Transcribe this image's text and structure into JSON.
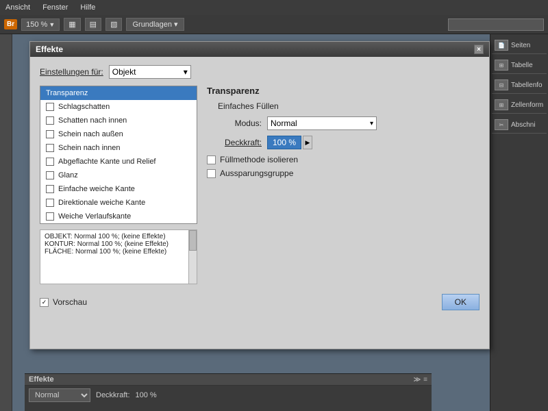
{
  "menubar": {
    "items": [
      "Ansicht",
      "Fenster",
      "Hilfe"
    ]
  },
  "toolbar": {
    "logo": "Br",
    "zoom": "150 %",
    "zoom_arrow": "▼",
    "layout_btn1": "▦",
    "layout_btn2": "▤",
    "layout_btn3": "▧",
    "grundlagen": "Grundlagen",
    "search_placeholder": ""
  },
  "modal": {
    "title": "Effekte",
    "settings_label": "Einstellungen für:",
    "settings_value": "Objekt",
    "right_title": "Transparenz",
    "section_fill": "Einfaches Füllen",
    "modus_label": "Modus:",
    "modus_value": "Normal",
    "deckkraft_label": "Deckkraft:",
    "deckkraft_value": "100 %",
    "cb_fuellmethode": "Füllmethode isolieren",
    "cb_aussparungsgruppe": "Aussparungsgruppe",
    "preview_label": "Vorschau",
    "ok_label": "OK",
    "preview_lines": [
      "OBJEKT: Normal 100 %; (keine Effekte)",
      "KONTUR: Normal 100 %; (keine Effekte)",
      "FLÄCHE: Normal 100 %; (keine Effekte)"
    ]
  },
  "effects_list": [
    {
      "label": "Transparenz",
      "selected": true,
      "checked": false
    },
    {
      "label": "Schlagschatten",
      "selected": false,
      "checked": false
    },
    {
      "label": "Schatten nach innen",
      "selected": false,
      "checked": false
    },
    {
      "label": "Schein nach außen",
      "selected": false,
      "checked": false
    },
    {
      "label": "Schein nach innen",
      "selected": false,
      "checked": false
    },
    {
      "label": "Abgeflachte Kante und Relief",
      "selected": false,
      "checked": false
    },
    {
      "label": "Glanz",
      "selected": false,
      "checked": false
    },
    {
      "label": "Einfache weiche Kante",
      "selected": false,
      "checked": false
    },
    {
      "label": "Direktionale weiche Kante",
      "selected": false,
      "checked": false
    },
    {
      "label": "Weiche Verlaufskante",
      "selected": false,
      "checked": false
    }
  ],
  "right_panel": [
    {
      "label": "Seiten",
      "icon": "📄"
    },
    {
      "label": "Tabelle",
      "icon": "⊞"
    },
    {
      "label": "Tabellenfo",
      "icon": "⊟"
    },
    {
      "label": "Zellenform",
      "icon": "⊞"
    },
    {
      "label": "Abschni",
      "icon": "✂"
    }
  ],
  "bottom_panel": {
    "title": "Effekte",
    "modus_value": "Normal",
    "deckkraft_label": "Deckkraft:",
    "deckkraft_value": "100 %"
  }
}
